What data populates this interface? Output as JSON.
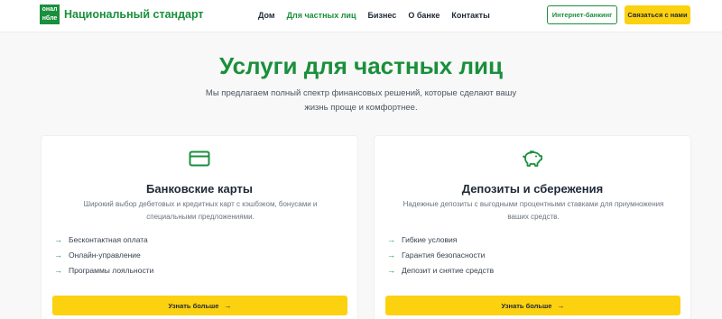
{
  "header": {
    "logo_lines": [
      "онал",
      "нбле"
    ],
    "logo_name": "Национальный стандарт",
    "nav": [
      {
        "label": "Дом",
        "active": false
      },
      {
        "label": "Для частных лиц",
        "active": true
      },
      {
        "label": "Бизнес",
        "active": false
      },
      {
        "label": "О банке",
        "active": false
      },
      {
        "label": "Контакты",
        "active": false
      }
    ],
    "internet_banking_label": "Интернет-банкинг",
    "contact_label": "Связаться с нами"
  },
  "hero": {
    "title": "Услуги для частных лиц",
    "subtitle": "Мы предлагаем полный спектр финансовых решений, которые сделают вашу жизнь проще и комфортнее."
  },
  "cards": [
    {
      "icon": "credit-card-icon",
      "title": "Банковские карты",
      "description": "Широкий выбор дебетовых и кредитных карт с кэшбэком, бонусами и специальными предложениями.",
      "features": [
        "Бесконтактная оплата",
        "Онлайн-управление",
        "Программы лояльности"
      ],
      "button_label": "Узнать больше"
    },
    {
      "icon": "piggy-bank-icon",
      "title": "Депозиты и сбережения",
      "description": "Надежные депозиты с выгодными процентными ставками для приумножения ваших средств.",
      "features": [
        "Гибкие условия",
        "Гарантия безопасности",
        "Депозит и снятие средств"
      ],
      "button_label": "Узнать больше"
    }
  ],
  "colors": {
    "brand_green": "#1a8f3c",
    "accent_yellow": "#fcd10f",
    "background": "#f7f8f7"
  }
}
